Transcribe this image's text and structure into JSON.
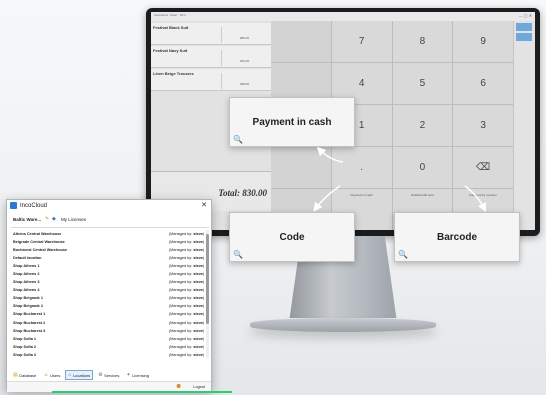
{
  "pos": {
    "titlebar": "IncoCloud · Posn · Till 1",
    "window_controls": "— ▢ ✕",
    "items": [
      {
        "name": "Festival Black Suit",
        "price": "286.00"
      },
      {
        "name": "Festival Navy Suit",
        "price": "160.00"
      },
      {
        "name": "Linen Beige Trousers",
        "price": "228.00"
      }
    ],
    "total": "Total: 830.00",
    "keypad": [
      "7",
      "8",
      "9",
      "4",
      "5",
      "6",
      "1",
      "2",
      "3",
      ".",
      "0",
      "⌫"
    ],
    "payment_keys": [
      "Payment in cash",
      "Debit/Credit card",
      "Payment by voucher"
    ],
    "bottom_keys": [
      "Code",
      "Barcode"
    ]
  },
  "callouts": {
    "cash": "Payment in cash",
    "code": "Code",
    "barcode": "Barcode"
  },
  "dialog": {
    "title": "IncoCloud",
    "close_glyph": "✕",
    "dropdown": "Baltic Ware...",
    "licenses": "My Licenses",
    "managed_prefix": "(Managed by: ",
    "managed_user": "steve",
    "managed_suffix": ")",
    "locations": [
      "Athens Central Warehouse",
      "Belgrade Central Warehouse",
      "Bucharest Central Warehouse",
      "Default location",
      "Shop Athens 1",
      "Shop Athens 2",
      "Shop Athens 3",
      "Shop Athens 4",
      "Shop Belgrade 1",
      "Shop Belgrade 2",
      "Shop Bucharest 1",
      "Shop Bucharest 2",
      "Shop Bucharest 3",
      "Shop Sofia 1",
      "Shop Sofia 2",
      "Shop Sofia 3"
    ],
    "tabs": [
      {
        "label": "Database",
        "icon": "▤",
        "color": "#d6a21e"
      },
      {
        "label": "Users",
        "icon": "☺",
        "color": "#d08a2a"
      },
      {
        "label": "Locations",
        "icon": "⌂",
        "color": "#3b78c4"
      },
      {
        "label": "Services",
        "icon": "⚙",
        "color": "#6b6b6b"
      },
      {
        "label": "Licensing",
        "icon": "✦",
        "color": "#c46b2b"
      }
    ],
    "active_tab": "Locations",
    "logout": "Logout"
  }
}
